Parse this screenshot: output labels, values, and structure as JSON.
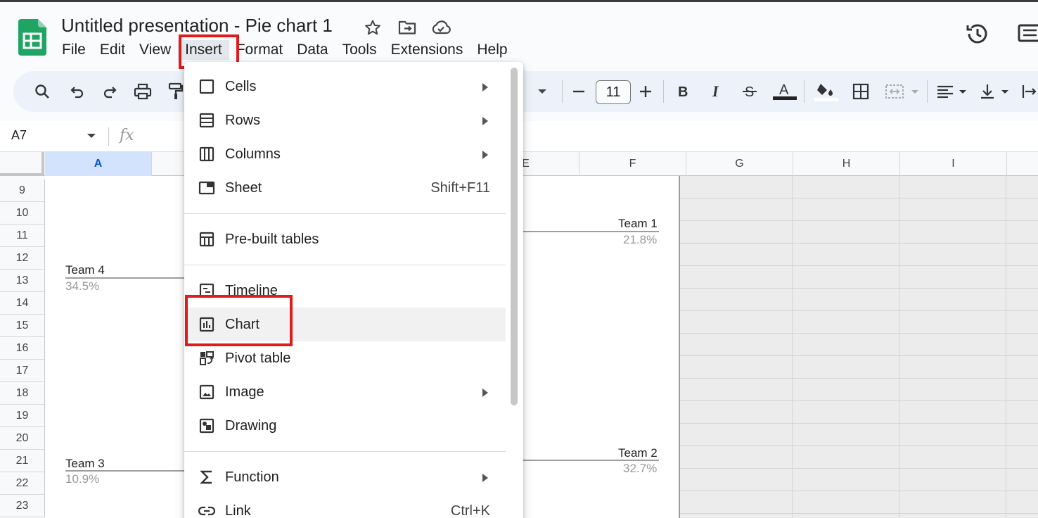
{
  "document": {
    "title": "Untitled presentation - Pie chart 1"
  },
  "menubar": {
    "items": [
      {
        "label": "File"
      },
      {
        "label": "Edit"
      },
      {
        "label": "View"
      },
      {
        "label": "Insert"
      },
      {
        "label": "Format"
      },
      {
        "label": "Data"
      },
      {
        "label": "Tools"
      },
      {
        "label": "Extensions"
      },
      {
        "label": "Help"
      }
    ]
  },
  "toolbar": {
    "font_size": "11"
  },
  "formula_bar": {
    "cell_ref": "A7",
    "fx": "fx"
  },
  "grid": {
    "columns": [
      "A",
      "E",
      "F",
      "G",
      "H",
      "I"
    ],
    "rows": [
      "9",
      "10",
      "11",
      "12",
      "13",
      "14",
      "15",
      "16",
      "17",
      "18",
      "19",
      "20",
      "21",
      "22",
      "23"
    ]
  },
  "chart": {
    "slices": [
      {
        "label": "Team 1",
        "percent": "21.8%"
      },
      {
        "label": "Team 2",
        "percent": "32.7%"
      },
      {
        "label": "Team 3",
        "percent": "10.9%"
      },
      {
        "label": "Team 4",
        "percent": "34.5%"
      }
    ]
  },
  "insert_menu": {
    "items": [
      {
        "label": "Cells",
        "icon": "square-outline-icon",
        "submenu": true
      },
      {
        "label": "Rows",
        "icon": "rows-icon",
        "submenu": true
      },
      {
        "label": "Columns",
        "icon": "columns-icon",
        "submenu": true
      },
      {
        "label": "Sheet",
        "icon": "sheet-icon",
        "shortcut": "Shift+F11"
      },
      {
        "label": "Pre-built tables",
        "icon": "table-icon"
      },
      {
        "label": "Timeline",
        "icon": "timeline-icon"
      },
      {
        "label": "Chart",
        "icon": "chart-icon"
      },
      {
        "label": "Pivot table",
        "icon": "pivot-table-icon"
      },
      {
        "label": "Image",
        "icon": "image-icon",
        "submenu": true
      },
      {
        "label": "Drawing",
        "icon": "drawing-icon"
      },
      {
        "label": "Function",
        "icon": "sigma-icon",
        "submenu": true
      },
      {
        "label": "Link",
        "icon": "link-icon",
        "shortcut": "Ctrl+K"
      }
    ]
  },
  "colors": {
    "highlight": "#e01b1b",
    "sheets_green": "#0f9d58",
    "selected_col": "#d3e3fd"
  }
}
